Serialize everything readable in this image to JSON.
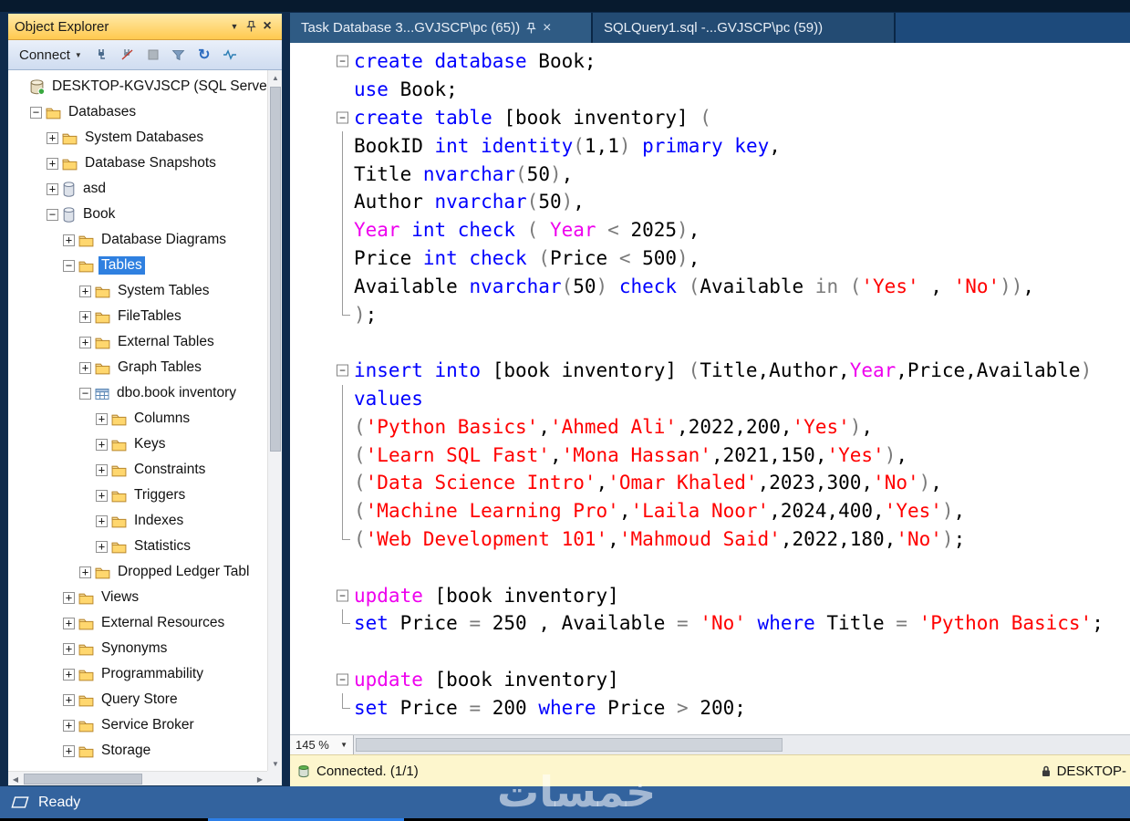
{
  "window": {
    "ready_label": "Ready",
    "watermark": "خمسات"
  },
  "glyphs": {
    "caret_down": "▼",
    "close": "×",
    "plus": "+",
    "minus": "−",
    "refresh": "↻",
    "scroll_up": "▲",
    "scroll_down": "▼",
    "scroll_left": "◀",
    "scroll_right": "▶"
  },
  "object_explorer": {
    "title": "Object Explorer",
    "connect_label": "Connect",
    "tree": [
      {
        "level": 0,
        "expand": "none",
        "icon": "server",
        "label": "DESKTOP-KGVJSCP (SQL Server",
        "selected": false
      },
      {
        "level": 1,
        "expand": "minus",
        "icon": "folder",
        "label": "Databases",
        "selected": false
      },
      {
        "level": 2,
        "expand": "plus",
        "icon": "folder",
        "label": "System Databases",
        "selected": false
      },
      {
        "level": 2,
        "expand": "plus",
        "icon": "folder",
        "label": "Database Snapshots",
        "selected": false
      },
      {
        "level": 2,
        "expand": "plus",
        "icon": "database",
        "label": "asd",
        "selected": false
      },
      {
        "level": 2,
        "expand": "minus",
        "icon": "database",
        "label": "Book",
        "selected": false
      },
      {
        "level": 3,
        "expand": "plus",
        "icon": "folder",
        "label": "Database Diagrams",
        "selected": false
      },
      {
        "level": 3,
        "expand": "minus",
        "icon": "folder",
        "label": "Tables",
        "selected": true
      },
      {
        "level": 4,
        "expand": "plus",
        "icon": "folder",
        "label": "System Tables",
        "selected": false
      },
      {
        "level": 4,
        "expand": "plus",
        "icon": "folder",
        "label": "FileTables",
        "selected": false
      },
      {
        "level": 4,
        "expand": "plus",
        "icon": "folder",
        "label": "External Tables",
        "selected": false
      },
      {
        "level": 4,
        "expand": "plus",
        "icon": "folder",
        "label": "Graph Tables",
        "selected": false
      },
      {
        "level": 4,
        "expand": "minus",
        "icon": "table",
        "label": "dbo.book inventory",
        "selected": false
      },
      {
        "level": 5,
        "expand": "plus",
        "icon": "folder",
        "label": "Columns",
        "selected": false
      },
      {
        "level": 5,
        "expand": "plus",
        "icon": "folder",
        "label": "Keys",
        "selected": false
      },
      {
        "level": 5,
        "expand": "plus",
        "icon": "folder",
        "label": "Constraints",
        "selected": false
      },
      {
        "level": 5,
        "expand": "plus",
        "icon": "folder",
        "label": "Triggers",
        "selected": false
      },
      {
        "level": 5,
        "expand": "plus",
        "icon": "folder",
        "label": "Indexes",
        "selected": false
      },
      {
        "level": 5,
        "expand": "plus",
        "icon": "folder",
        "label": "Statistics",
        "selected": false
      },
      {
        "level": 4,
        "expand": "plus",
        "icon": "folder",
        "label": "Dropped Ledger Tabl",
        "selected": false
      },
      {
        "level": 3,
        "expand": "plus",
        "icon": "folder",
        "label": "Views",
        "selected": false
      },
      {
        "level": 3,
        "expand": "plus",
        "icon": "folder",
        "label": "External Resources",
        "selected": false
      },
      {
        "level": 3,
        "expand": "plus",
        "icon": "folder",
        "label": "Synonyms",
        "selected": false
      },
      {
        "level": 3,
        "expand": "plus",
        "icon": "folder",
        "label": "Programmability",
        "selected": false
      },
      {
        "level": 3,
        "expand": "plus",
        "icon": "folder",
        "label": "Query Store",
        "selected": false
      },
      {
        "level": 3,
        "expand": "plus",
        "icon": "folder",
        "label": "Service Broker",
        "selected": false
      },
      {
        "level": 3,
        "expand": "plus",
        "icon": "folder",
        "label": "Storage",
        "selected": false
      }
    ]
  },
  "tabs": [
    {
      "label": "Task Database 3...GVJSCP\\pc (65))",
      "active": true
    },
    {
      "label": "SQLQuery1.sql -...GVJSCP\\pc (59))",
      "active": false
    }
  ],
  "editor": {
    "zoom": "145 %",
    "colors": {
      "k": "#0000ff",
      "i": "#000000",
      "s": "#ff0000",
      "f": "#ee00ee",
      "o": "#7a7a7a",
      "n": "#000000"
    },
    "lines": [
      {
        "fold": "open",
        "tokens": [
          [
            "k",
            "create database"
          ],
          [
            "i",
            " Book;"
          ]
        ]
      },
      {
        "fold": "none",
        "tokens": [
          [
            "k",
            "use"
          ],
          [
            "i",
            " Book;"
          ]
        ]
      },
      {
        "fold": "open",
        "tokens": [
          [
            "k",
            "create table"
          ],
          [
            "i",
            " [book inventory] "
          ],
          [
            "o",
            "("
          ]
        ]
      },
      {
        "fold": "line",
        "tokens": [
          [
            "i",
            "BookID "
          ],
          [
            "k",
            "int identity"
          ],
          [
            "o",
            "("
          ],
          [
            "n",
            "1"
          ],
          [
            "i",
            ","
          ],
          [
            "n",
            "1"
          ],
          [
            "o",
            ")"
          ],
          [
            "k",
            " primary key"
          ],
          [
            "i",
            ","
          ]
        ]
      },
      {
        "fold": "line",
        "tokens": [
          [
            "i",
            "Title "
          ],
          [
            "k",
            "nvarchar"
          ],
          [
            "o",
            "("
          ],
          [
            "n",
            "50"
          ],
          [
            "o",
            ")"
          ],
          [
            "i",
            ","
          ]
        ]
      },
      {
        "fold": "line",
        "tokens": [
          [
            "i",
            "Author "
          ],
          [
            "k",
            "nvarchar"
          ],
          [
            "o",
            "("
          ],
          [
            "n",
            "50"
          ],
          [
            "o",
            ")"
          ],
          [
            "i",
            ","
          ]
        ]
      },
      {
        "fold": "line",
        "tokens": [
          [
            "f",
            "Year"
          ],
          [
            "k",
            " int check"
          ],
          [
            "o",
            " ( "
          ],
          [
            "f",
            "Year"
          ],
          [
            "o",
            " < "
          ],
          [
            "n",
            "2025"
          ],
          [
            "o",
            ")"
          ],
          [
            "i",
            ","
          ]
        ]
      },
      {
        "fold": "line",
        "tokens": [
          [
            "i",
            "Price "
          ],
          [
            "k",
            "int check"
          ],
          [
            "o",
            " ("
          ],
          [
            "i",
            "Price"
          ],
          [
            "o",
            " < "
          ],
          [
            "n",
            "500"
          ],
          [
            "o",
            ")"
          ],
          [
            "i",
            ","
          ]
        ]
      },
      {
        "fold": "line",
        "tokens": [
          [
            "i",
            "Available "
          ],
          [
            "k",
            "nvarchar"
          ],
          [
            "o",
            "("
          ],
          [
            "n",
            "50"
          ],
          [
            "o",
            ")"
          ],
          [
            "k",
            " check"
          ],
          [
            "o",
            " ("
          ],
          [
            "i",
            "Available"
          ],
          [
            "o",
            " in "
          ],
          [
            "o",
            "("
          ],
          [
            "s",
            "'Yes'"
          ],
          [
            "i",
            " , "
          ],
          [
            "s",
            "'No'"
          ],
          [
            "o",
            "))"
          ],
          [
            "i",
            ","
          ]
        ]
      },
      {
        "fold": "end",
        "tokens": [
          [
            "o",
            ")"
          ],
          [
            "i",
            ";"
          ]
        ]
      },
      {
        "fold": "none",
        "tokens": []
      },
      {
        "fold": "open",
        "tokens": [
          [
            "k",
            "insert into"
          ],
          [
            "i",
            " [book inventory] "
          ],
          [
            "o",
            "("
          ],
          [
            "i",
            "Title,Author,"
          ],
          [
            "f",
            "Year"
          ],
          [
            "i",
            ",Price,Available"
          ],
          [
            "o",
            ")"
          ]
        ]
      },
      {
        "fold": "line",
        "tokens": [
          [
            "k",
            "values"
          ]
        ]
      },
      {
        "fold": "line",
        "tokens": [
          [
            "o",
            "("
          ],
          [
            "s",
            "'Python Basics'"
          ],
          [
            "i",
            ","
          ],
          [
            "s",
            "'Ahmed Ali'"
          ],
          [
            "i",
            ","
          ],
          [
            "n",
            "2022"
          ],
          [
            "i",
            ","
          ],
          [
            "n",
            "200"
          ],
          [
            "i",
            ","
          ],
          [
            "s",
            "'Yes'"
          ],
          [
            "o",
            ")"
          ],
          [
            "i",
            ","
          ]
        ]
      },
      {
        "fold": "line",
        "tokens": [
          [
            "o",
            "("
          ],
          [
            "s",
            "'Learn SQL Fast'"
          ],
          [
            "i",
            ","
          ],
          [
            "s",
            "'Mona Hassan'"
          ],
          [
            "i",
            ","
          ],
          [
            "n",
            "2021"
          ],
          [
            "i",
            ","
          ],
          [
            "n",
            "150"
          ],
          [
            "i",
            ","
          ],
          [
            "s",
            "'Yes'"
          ],
          [
            "o",
            ")"
          ],
          [
            "i",
            ","
          ]
        ]
      },
      {
        "fold": "line",
        "tokens": [
          [
            "o",
            "("
          ],
          [
            "s",
            "'Data Science Intro'"
          ],
          [
            "i",
            ","
          ],
          [
            "s",
            "'Omar Khaled'"
          ],
          [
            "i",
            ","
          ],
          [
            "n",
            "2023"
          ],
          [
            "i",
            ","
          ],
          [
            "n",
            "300"
          ],
          [
            "i",
            ","
          ],
          [
            "s",
            "'No'"
          ],
          [
            "o",
            ")"
          ],
          [
            "i",
            ","
          ]
        ]
      },
      {
        "fold": "line",
        "tokens": [
          [
            "o",
            "("
          ],
          [
            "s",
            "'Machine Learning Pro'"
          ],
          [
            "i",
            ","
          ],
          [
            "s",
            "'Laila Noor'"
          ],
          [
            "i",
            ","
          ],
          [
            "n",
            "2024"
          ],
          [
            "i",
            ","
          ],
          [
            "n",
            "400"
          ],
          [
            "i",
            ","
          ],
          [
            "s",
            "'Yes'"
          ],
          [
            "o",
            ")"
          ],
          [
            "i",
            ","
          ]
        ]
      },
      {
        "fold": "end",
        "tokens": [
          [
            "o",
            "("
          ],
          [
            "s",
            "'Web Development 101'"
          ],
          [
            "i",
            ","
          ],
          [
            "s",
            "'Mahmoud Said'"
          ],
          [
            "i",
            ","
          ],
          [
            "n",
            "2022"
          ],
          [
            "i",
            ","
          ],
          [
            "n",
            "180"
          ],
          [
            "i",
            ","
          ],
          [
            "s",
            "'No'"
          ],
          [
            "o",
            ")"
          ],
          [
            "i",
            ";"
          ]
        ]
      },
      {
        "fold": "none",
        "tokens": []
      },
      {
        "fold": "open",
        "tokens": [
          [
            "f",
            "update"
          ],
          [
            "i",
            " [book inventory]"
          ]
        ]
      },
      {
        "fold": "end",
        "tokens": [
          [
            "k",
            "set"
          ],
          [
            "i",
            " Price"
          ],
          [
            "o",
            " = "
          ],
          [
            "n",
            "250"
          ],
          [
            "i",
            " , Available"
          ],
          [
            "o",
            " = "
          ],
          [
            "s",
            "'No'"
          ],
          [
            "k",
            " where"
          ],
          [
            "i",
            " Title"
          ],
          [
            "o",
            " = "
          ],
          [
            "s",
            "'Python Basics'"
          ],
          [
            "i",
            ";"
          ]
        ]
      },
      {
        "fold": "none",
        "tokens": []
      },
      {
        "fold": "open",
        "tokens": [
          [
            "f",
            "update"
          ],
          [
            "i",
            " [book inventory]"
          ]
        ]
      },
      {
        "fold": "end",
        "tokens": [
          [
            "k",
            "set"
          ],
          [
            "i",
            " Price"
          ],
          [
            "o",
            " = "
          ],
          [
            "n",
            "200"
          ],
          [
            "k",
            " where"
          ],
          [
            "i",
            " Price"
          ],
          [
            "o",
            " > "
          ],
          [
            "n",
            "200"
          ],
          [
            "i",
            ";"
          ]
        ]
      }
    ]
  },
  "status": {
    "connected": "Connected. (1/1)",
    "server": "DESKTOP-"
  }
}
